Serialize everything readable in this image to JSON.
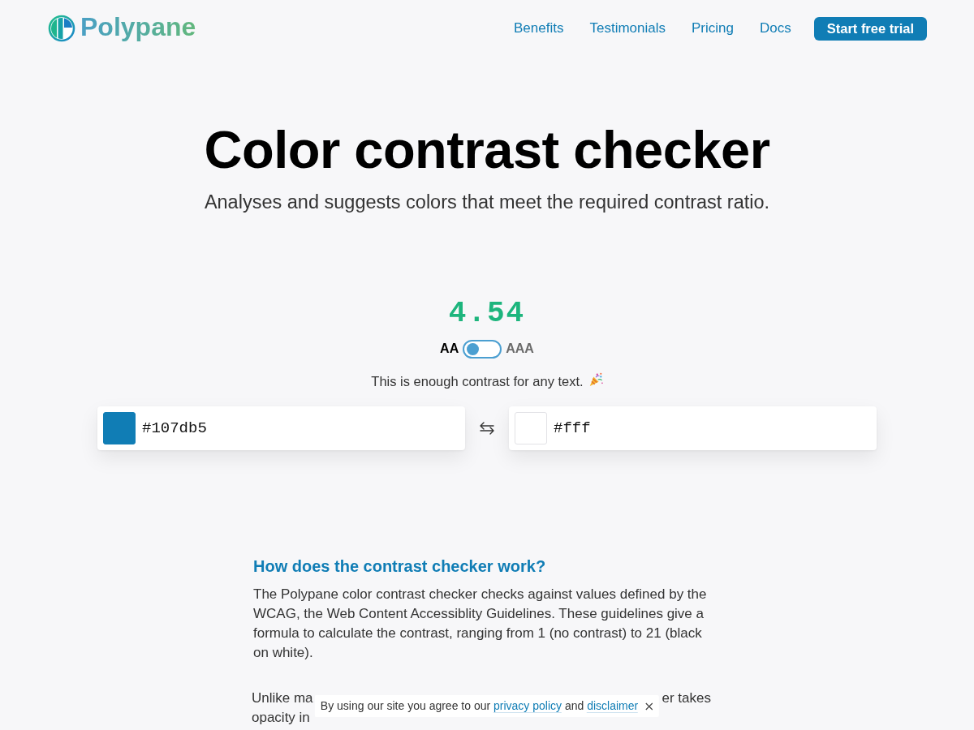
{
  "header": {
    "logo_text": "Polypane",
    "nav": [
      {
        "label": "Benefits"
      },
      {
        "label": "Testimonials"
      },
      {
        "label": "Pricing"
      },
      {
        "label": "Docs"
      }
    ],
    "cta": "Start free trial"
  },
  "hero": {
    "title": "Color contrast checker",
    "subtitle": "Analyses and suggests colors that meet the required contrast ratio."
  },
  "checker": {
    "ratio": "4.54",
    "levels": [
      {
        "label": "AA",
        "selected": true
      },
      {
        "label": "AAA",
        "selected": false
      }
    ],
    "message": "This is enough contrast for any text.",
    "colors": [
      {
        "value": "#107db5",
        "color": "#107db5"
      },
      {
        "value": "#fff",
        "color": "#ffffff"
      }
    ]
  },
  "article": {
    "heading": "How does the contrast checker work?",
    "paragraphs": [
      "The Polypane color contrast checker checks against values defined by the WCAG, the Web Content Accessiblity Guidelines. These guidelines give a formula to calculate the contrast, ranging from 1 (no contrast) to 21 (black on white)."
    ],
    "covered_paragraph": {
      "lines": [
        {
          "visible_parts": [
            "Unlike ma",
            "er takes"
          ]
        },
        {
          "visible_parts": [
            "opacity in"
          ]
        }
      ]
    }
  },
  "cookie_banner": {
    "segments": [
      {
        "kind": "text",
        "text": "By using our site you agree to our"
      },
      {
        "kind": "link",
        "text": "privacy policy"
      },
      {
        "kind": "text",
        "text": "and"
      },
      {
        "kind": "link",
        "text": "disclaimer"
      }
    ]
  }
}
